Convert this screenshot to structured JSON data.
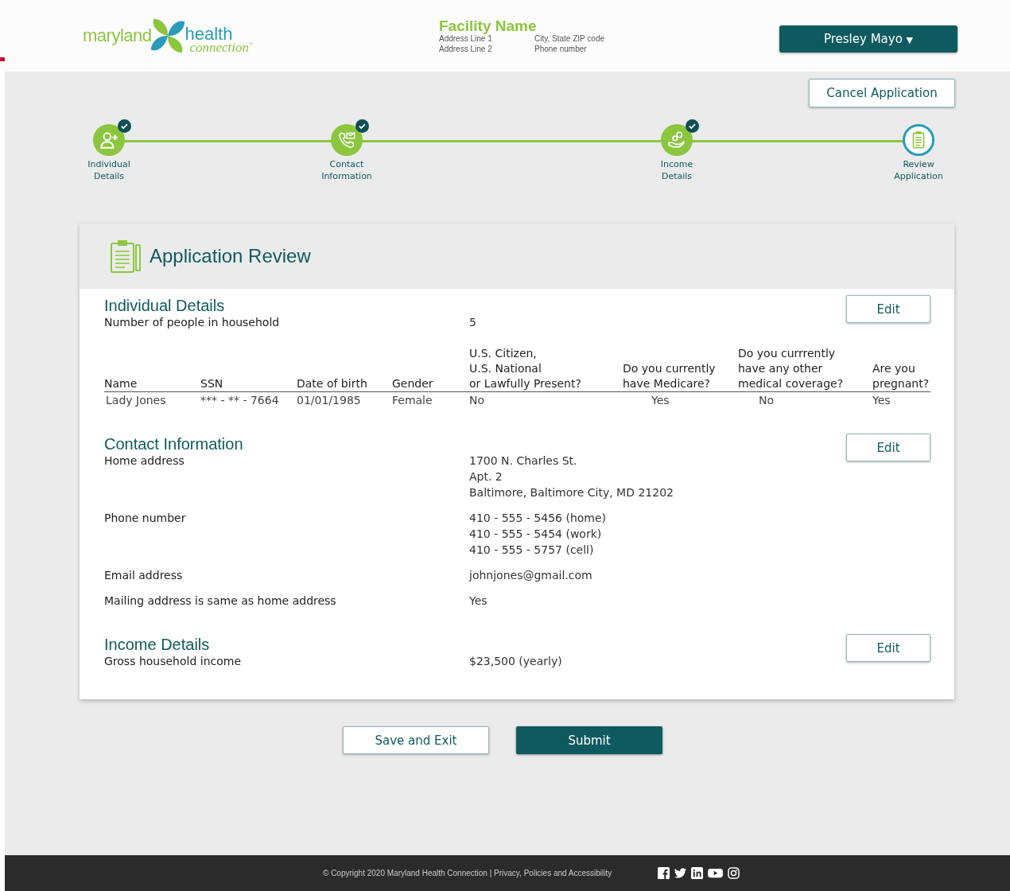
{
  "logo": {
    "word1": "maryland",
    "word2": "health",
    "word3": "connection",
    "mark": "℠"
  },
  "facility": {
    "name": "Facility Name",
    "lines": [
      "Address Line 1",
      "City, State ZIP code",
      "Address Line 2",
      "Phone number"
    ]
  },
  "user_menu": {
    "label": "Presley Mayo",
    "caret": "▼"
  },
  "cancel_button": "Cancel Application",
  "steps": [
    {
      "label": "Individual\nDetails",
      "completed": true,
      "selected": false
    },
    {
      "label": "Contact\nInformation",
      "completed": true,
      "selected": false
    },
    {
      "label": "Income\nDetails",
      "completed": true,
      "selected": false
    },
    {
      "label": "Review\nApplication",
      "completed": false,
      "selected": true
    }
  ],
  "review": {
    "title": "Application Review",
    "individual": {
      "heading": "Individual Details",
      "edit": "Edit",
      "rows": [
        {
          "label": "Number of people in household",
          "value": [
            "5"
          ]
        }
      ],
      "table": {
        "columns": [
          "Name",
          "SSN",
          "Date of birth",
          "Gender",
          "U.S. Citizen,\nU.S. National\nor Lawfully Present?",
          "Do you currently\nhave Medicare?",
          "Do you currrently\nhave any other\nmedical coverage?",
          "Are you\npregnant?"
        ],
        "rows": [
          [
            "Lady Jones",
            "*** - ** - 7664",
            "01/01/1985",
            "Female",
            "No",
            "Yes",
            "No",
            "Yes"
          ]
        ]
      }
    },
    "contact": {
      "heading": "Contact Information",
      "edit": "Edit",
      "rows": [
        {
          "label": "Home address",
          "value": [
            "1700 N. Charles St.",
            "Apt. 2",
            "Baltimore, Baltimore City, MD 21202"
          ]
        },
        {
          "label": "Phone number",
          "value": [
            "410 - 555 - 5456 (home)",
            "410 - 555 - 5454 (work)",
            "410 - 555 - 5757 (cell)"
          ]
        },
        {
          "label": "Email address",
          "value": [
            "johnjones@gmail.com"
          ]
        },
        {
          "label": "Mailing address is same as home address",
          "value": [
            "Yes"
          ]
        }
      ]
    },
    "income": {
      "heading": "Income Details",
      "edit": "Edit",
      "rows": [
        {
          "label": "Gross household income",
          "value": [
            "$23,500 (yearly)"
          ]
        }
      ]
    }
  },
  "actions": [
    "Save and Exit",
    "Submit"
  ],
  "footer": {
    "copyright": "© Copyright 2020 Maryland Health Connection | Privacy, Policies and Accessibility"
  }
}
